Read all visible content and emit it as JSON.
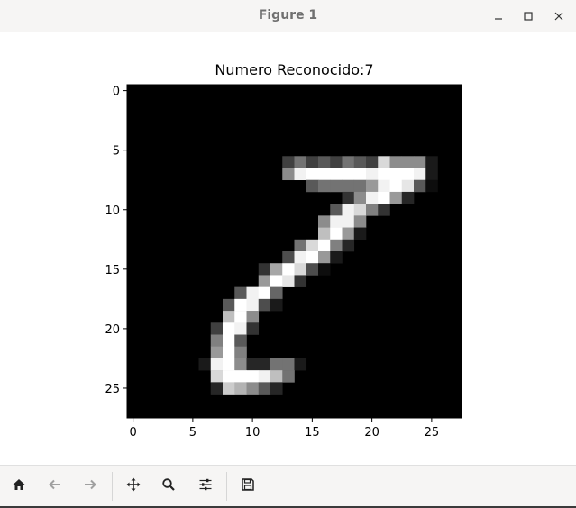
{
  "window": {
    "title": "Figure 1",
    "controls": [
      "minimize-icon",
      "maximize-icon",
      "close-icon"
    ]
  },
  "plot": {
    "title": "Numero Reconocido:7"
  },
  "chart_data": {
    "type": "heatmap",
    "colormap": "gray",
    "title": "Numero Reconocido:7",
    "grid": false,
    "x_ticks": [
      "0",
      "5",
      "10",
      "15",
      "20",
      "25"
    ],
    "y_ticks": [
      "0",
      "5",
      "10",
      "15",
      "20",
      "25"
    ],
    "xlim": [
      -0.5,
      27.5
    ],
    "ylim": [
      27.5,
      -0.5
    ],
    "rows": 28,
    "cols": 28,
    "pixels": [
      {
        "r": 6,
        "c": 13,
        "v": 0.25
      },
      {
        "r": 6,
        "c": 14,
        "v": 0.45
      },
      {
        "r": 6,
        "c": 15,
        "v": 0.25
      },
      {
        "r": 6,
        "c": 16,
        "v": 0.35
      },
      {
        "r": 6,
        "c": 17,
        "v": 0.25
      },
      {
        "r": 6,
        "c": 18,
        "v": 0.45
      },
      {
        "r": 6,
        "c": 19,
        "v": 0.35
      },
      {
        "r": 6,
        "c": 20,
        "v": 0.25
      },
      {
        "r": 6,
        "c": 21,
        "v": 0.85
      },
      {
        "r": 6,
        "c": 22,
        "v": 0.55
      },
      {
        "r": 6,
        "c": 23,
        "v": 0.55
      },
      {
        "r": 6,
        "c": 24,
        "v": 0.55
      },
      {
        "r": 6,
        "c": 25,
        "v": 0.1
      },
      {
        "r": 7,
        "c": 13,
        "v": 0.55
      },
      {
        "r": 7,
        "c": 14,
        "v": 0.95
      },
      {
        "r": 7,
        "c": 15,
        "v": 1.0
      },
      {
        "r": 7,
        "c": 16,
        "v": 1.0
      },
      {
        "r": 7,
        "c": 17,
        "v": 1.0
      },
      {
        "r": 7,
        "c": 18,
        "v": 1.0
      },
      {
        "r": 7,
        "c": 19,
        "v": 1.0
      },
      {
        "r": 7,
        "c": 20,
        "v": 0.95
      },
      {
        "r": 7,
        "c": 21,
        "v": 1.0
      },
      {
        "r": 7,
        "c": 22,
        "v": 1.0
      },
      {
        "r": 7,
        "c": 23,
        "v": 1.0
      },
      {
        "r": 7,
        "c": 24,
        "v": 0.95
      },
      {
        "r": 7,
        "c": 25,
        "v": 0.1
      },
      {
        "r": 8,
        "c": 15,
        "v": 0.35
      },
      {
        "r": 8,
        "c": 16,
        "v": 0.45
      },
      {
        "r": 8,
        "c": 17,
        "v": 0.45
      },
      {
        "r": 8,
        "c": 18,
        "v": 0.45
      },
      {
        "r": 8,
        "c": 19,
        "v": 0.45
      },
      {
        "r": 8,
        "c": 20,
        "v": 0.6
      },
      {
        "r": 8,
        "c": 21,
        "v": 0.95
      },
      {
        "r": 8,
        "c": 22,
        "v": 1.0
      },
      {
        "r": 8,
        "c": 23,
        "v": 0.9
      },
      {
        "r": 8,
        "c": 24,
        "v": 0.35
      },
      {
        "r": 8,
        "c": 25,
        "v": 0.05
      },
      {
        "r": 9,
        "c": 18,
        "v": 0.2
      },
      {
        "r": 9,
        "c": 19,
        "v": 0.55
      },
      {
        "r": 9,
        "c": 20,
        "v": 0.95
      },
      {
        "r": 9,
        "c": 21,
        "v": 1.0
      },
      {
        "r": 9,
        "c": 22,
        "v": 0.6
      },
      {
        "r": 9,
        "c": 23,
        "v": 0.15
      },
      {
        "r": 10,
        "c": 17,
        "v": 0.35
      },
      {
        "r": 10,
        "c": 18,
        "v": 0.95
      },
      {
        "r": 10,
        "c": 19,
        "v": 0.85
      },
      {
        "r": 10,
        "c": 20,
        "v": 0.5
      },
      {
        "r": 10,
        "c": 21,
        "v": 0.2
      },
      {
        "r": 11,
        "c": 16,
        "v": 0.55
      },
      {
        "r": 11,
        "c": 17,
        "v": 0.95
      },
      {
        "r": 11,
        "c": 18,
        "v": 0.95
      },
      {
        "r": 11,
        "c": 19,
        "v": 0.55
      },
      {
        "r": 12,
        "c": 16,
        "v": 0.75
      },
      {
        "r": 12,
        "c": 17,
        "v": 1.0
      },
      {
        "r": 12,
        "c": 18,
        "v": 0.6
      },
      {
        "r": 12,
        "c": 19,
        "v": 0.1
      },
      {
        "r": 13,
        "c": 14,
        "v": 0.45
      },
      {
        "r": 13,
        "c": 15,
        "v": 0.85
      },
      {
        "r": 13,
        "c": 16,
        "v": 1.0
      },
      {
        "r": 13,
        "c": 17,
        "v": 0.5
      },
      {
        "r": 13,
        "c": 18,
        "v": 0.15
      },
      {
        "r": 14,
        "c": 13,
        "v": 0.3
      },
      {
        "r": 14,
        "c": 14,
        "v": 0.95
      },
      {
        "r": 14,
        "c": 15,
        "v": 1.0
      },
      {
        "r": 14,
        "c": 16,
        "v": 0.6
      },
      {
        "r": 14,
        "c": 17,
        "v": 0.1
      },
      {
        "r": 15,
        "c": 11,
        "v": 0.2
      },
      {
        "r": 15,
        "c": 12,
        "v": 0.65
      },
      {
        "r": 15,
        "c": 13,
        "v": 1.0
      },
      {
        "r": 15,
        "c": 14,
        "v": 0.85
      },
      {
        "r": 15,
        "c": 15,
        "v": 0.3
      },
      {
        "r": 15,
        "c": 16,
        "v": 0.05
      },
      {
        "r": 16,
        "c": 11,
        "v": 0.6
      },
      {
        "r": 16,
        "c": 12,
        "v": 1.0
      },
      {
        "r": 16,
        "c": 13,
        "v": 0.9
      },
      {
        "r": 16,
        "c": 14,
        "v": 0.2
      },
      {
        "r": 17,
        "c": 9,
        "v": 0.35
      },
      {
        "r": 17,
        "c": 10,
        "v": 0.95
      },
      {
        "r": 17,
        "c": 11,
        "v": 1.0
      },
      {
        "r": 17,
        "c": 12,
        "v": 0.4
      },
      {
        "r": 18,
        "c": 8,
        "v": 0.35
      },
      {
        "r": 18,
        "c": 9,
        "v": 1.0
      },
      {
        "r": 18,
        "c": 10,
        "v": 0.95
      },
      {
        "r": 18,
        "c": 11,
        "v": 0.3
      },
      {
        "r": 18,
        "c": 12,
        "v": 0.1
      },
      {
        "r": 19,
        "c": 8,
        "v": 0.75
      },
      {
        "r": 19,
        "c": 9,
        "v": 1.0
      },
      {
        "r": 19,
        "c": 10,
        "v": 0.55
      },
      {
        "r": 20,
        "c": 7,
        "v": 0.25
      },
      {
        "r": 20,
        "c": 8,
        "v": 1.0
      },
      {
        "r": 20,
        "c": 9,
        "v": 0.95
      },
      {
        "r": 20,
        "c": 10,
        "v": 0.2
      },
      {
        "r": 21,
        "c": 7,
        "v": 0.5
      },
      {
        "r": 21,
        "c": 8,
        "v": 1.0
      },
      {
        "r": 21,
        "c": 9,
        "v": 0.35
      },
      {
        "r": 22,
        "c": 7,
        "v": 0.6
      },
      {
        "r": 22,
        "c": 8,
        "v": 1.0
      },
      {
        "r": 22,
        "c": 9,
        "v": 0.5
      },
      {
        "r": 23,
        "c": 6,
        "v": 0.1
      },
      {
        "r": 23,
        "c": 7,
        "v": 0.95
      },
      {
        "r": 23,
        "c": 8,
        "v": 1.0
      },
      {
        "r": 23,
        "c": 9,
        "v": 0.55
      },
      {
        "r": 23,
        "c": 10,
        "v": 0.15
      },
      {
        "r": 23,
        "c": 11,
        "v": 0.15
      },
      {
        "r": 23,
        "c": 12,
        "v": 0.45
      },
      {
        "r": 23,
        "c": 13,
        "v": 0.45
      },
      {
        "r": 23,
        "c": 14,
        "v": 0.1
      },
      {
        "r": 24,
        "c": 7,
        "v": 0.85
      },
      {
        "r": 24,
        "c": 8,
        "v": 1.0
      },
      {
        "r": 24,
        "c": 9,
        "v": 1.0
      },
      {
        "r": 24,
        "c": 10,
        "v": 1.0
      },
      {
        "r": 24,
        "c": 11,
        "v": 0.95
      },
      {
        "r": 24,
        "c": 12,
        "v": 0.75
      },
      {
        "r": 24,
        "c": 13,
        "v": 0.45
      },
      {
        "r": 25,
        "c": 7,
        "v": 0.15
      },
      {
        "r": 25,
        "c": 8,
        "v": 0.8
      },
      {
        "r": 25,
        "c": 9,
        "v": 0.7
      },
      {
        "r": 25,
        "c": 10,
        "v": 0.55
      },
      {
        "r": 25,
        "c": 11,
        "v": 0.35
      },
      {
        "r": 25,
        "c": 12,
        "v": 0.15
      }
    ]
  },
  "toolbar": {
    "tools": [
      {
        "icon": "home-icon",
        "enabled": true
      },
      {
        "icon": "back-arrow-icon",
        "enabled": false
      },
      {
        "icon": "forward-arrow-icon",
        "enabled": false
      },
      {
        "icon": "pan-move-icon",
        "enabled": true
      },
      {
        "icon": "zoom-magnifier-icon",
        "enabled": true
      },
      {
        "icon": "subplots-sliders-icon",
        "enabled": true
      },
      {
        "icon": "save-floppy-icon",
        "enabled": true
      }
    ]
  }
}
